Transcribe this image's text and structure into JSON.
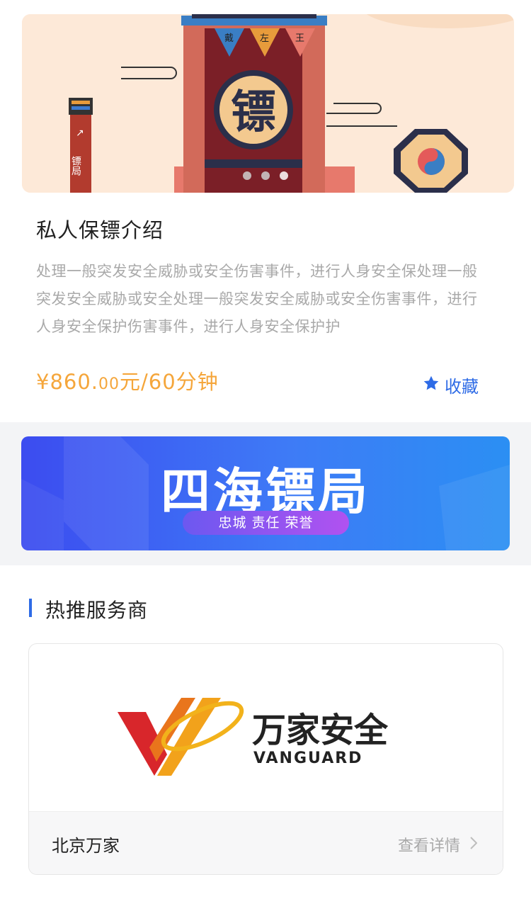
{
  "banner": {
    "flag_chars": [
      "戴",
      "左",
      "王"
    ],
    "big_char": "镖",
    "post_arrow": "↗",
    "post_text": "镖局",
    "slides": 3,
    "active_slide": 3
  },
  "service": {
    "title": "私人保镖介绍",
    "description": "处理一般突发安全威胁或安全伤害事件，进行人身安全保处理一般突发安全威胁或安全处理一般突发安全威胁或安全伤害事件，进行人身安全保护伤害事件，进行人身安全保护护",
    "price_symbol": "¥860.",
    "price_cents": "00",
    "price_unit": "元/60分钟",
    "favorite_label": "收藏"
  },
  "ad": {
    "title": "四海镖局",
    "slogan": "忠城  责任  荣誉"
  },
  "hot": {
    "section_title": "热推服务商",
    "providers": [
      {
        "logo_cn": "万家安全",
        "logo_en": "VANGUARD",
        "name": "北京万家",
        "detail_label": "查看详情"
      }
    ]
  },
  "colors": {
    "accent": "#2e6be6",
    "price": "#f5a63b",
    "text_muted": "#a9a9a9"
  }
}
